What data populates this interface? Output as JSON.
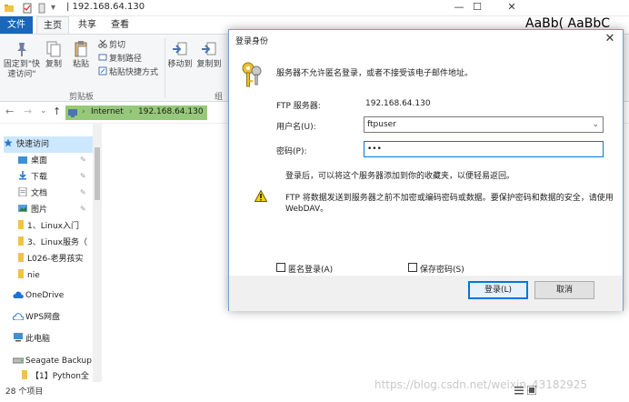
{
  "window": {
    "title": "| 192.168.64.130",
    "minimize": "—",
    "maximize": "☐",
    "close": "✕"
  },
  "ribbon_tabs": [
    "文件",
    "主页",
    "共享",
    "查看"
  ],
  "ribbon": {
    "pin_label": "固定到\"快速访问\"",
    "copy_label": "复制",
    "paste_label": "粘贴",
    "cut_label": "剪切",
    "copy_path_label": "复制路径",
    "paste_shortcut_label": "粘贴快捷方式",
    "move_to_label": "移动到",
    "copy_to_label": "复制到",
    "clipboard_group": "剪贴板",
    "organize_group": "组"
  },
  "styles_preview": "AaBb( AaBbC",
  "address": {
    "crumbs": [
      "Internet",
      "192.168.64.130"
    ],
    "back": "←",
    "forward": "→",
    "recent": "⌄",
    "up": "↑"
  },
  "nav_pane": {
    "items": [
      {
        "label": "快速访问",
        "pinned": false
      },
      {
        "label": "桌面",
        "pinned": true
      },
      {
        "label": "下载",
        "pinned": true
      },
      {
        "label": "文档",
        "pinned": true
      },
      {
        "label": "图片",
        "pinned": true
      },
      {
        "label": "1、Linux入门",
        "pinned": false
      },
      {
        "label": "3、Linux服务（",
        "pinned": false
      },
      {
        "label": "L026-老男孩实",
        "pinned": false
      },
      {
        "label": "nie",
        "pinned": false
      },
      {
        "label": "OneDrive",
        "pinned": false
      },
      {
        "label": "WPS网盘",
        "pinned": false
      },
      {
        "label": "此电脑",
        "pinned": false
      },
      {
        "label": "Seagate Backup",
        "pinned": false
      },
      {
        "label": "【1】Python全",
        "pinned": false
      }
    ],
    "pin_glyph": "✎"
  },
  "status": {
    "count": "28 个项目"
  },
  "watermark": "https://blog.csdn.net/weixin_43182925",
  "dialog": {
    "title": "登录身份",
    "close": "✕",
    "message": "服务器不允许匿名登录，或者不接受该电子邮件地址。",
    "ftp_server_label": "FTP 服务器:",
    "ftp_server_value": "192.168.64.130",
    "username_label": "用户名(U):",
    "username_value": "ftpuser",
    "password_label": "密码(P):",
    "password_value": "•••",
    "after_login_note": "登录后，可以将这个服务器添加到你的收藏夹，以便轻易返回。",
    "warning_line1": "FTP 将数据发送到服务器之前不加密或编码密码或数据。要保护密码和数据的安全，请使用",
    "warning_line2": "WebDAV。",
    "anonymous_label": "匿名登录(A)",
    "anonymous_checked": false,
    "save_password_label": "保存密码(S)",
    "save_password_checked": false,
    "login_button": "登录(L)",
    "cancel_button": "取消"
  },
  "colors": {
    "file_tab": "#1a66b8",
    "address_bg": "#96c87a",
    "primary_border": "#0078d7"
  }
}
